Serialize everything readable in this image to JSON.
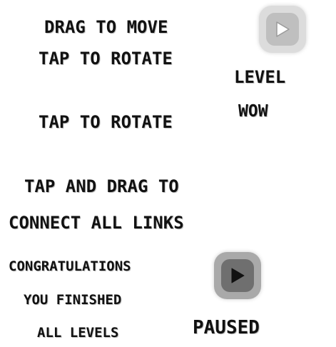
{
  "labels": {
    "drag_to_move": "DRAG TO MOVE",
    "tap_to_rotate_1": "TAP TO ROTATE",
    "tap_to_rotate_2": "TAP TO ROTATE",
    "level": "LEVEL",
    "wow": "WOW",
    "tap_and_drag_to": "TAP AND DRAG TO",
    "connect_all_links": "CONNECT ALL LINKS",
    "congratulations": "CONGRATULATIONS",
    "you_finished": "YOU FINISHED",
    "all_levels": "ALL LEVELS",
    "paused": "PAUSED"
  },
  "buttons": {
    "play_light": {
      "icon": "play-icon",
      "color": "#d9d9d9",
      "inner": "#bdbdbd",
      "glyph": "#ffffff"
    },
    "play_dark": {
      "icon": "play-icon",
      "color": "#a8a8a8",
      "inner": "#707070",
      "glyph": "#111111"
    }
  }
}
